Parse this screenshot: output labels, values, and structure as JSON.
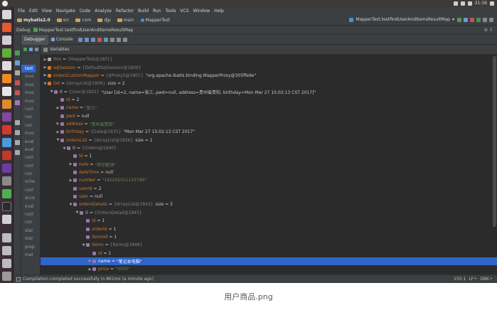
{
  "top_panel": {
    "tray_items": [
      "✉",
      "⇅",
      "♪",
      "21:16",
      "⚙"
    ]
  },
  "menu": {
    "items": [
      "File",
      "Edit",
      "View",
      "Navigate",
      "Code",
      "Analyze",
      "Refactor",
      "Build",
      "Run",
      "Tools",
      "VCS",
      "Window",
      "Help"
    ]
  },
  "nav": {
    "crumbs": [
      "mybatis2.0",
      "src",
      "com",
      "djp",
      "main",
      "MapperTest"
    ],
    "run_config": "MapperTest.testfindUserAndItemsResultMap"
  },
  "debug": {
    "title": "Debug",
    "config_name": "MapperTest.testfindUserAndItemsResultMap",
    "right_icons": "⚙ ↧"
  },
  "tabs": {
    "debugger": "Debugger",
    "console": "Console",
    "toolbar_icons": [
      "↑",
      "↓",
      "↘",
      "↗",
      "↱",
      "⦿",
      "⊕",
      "≡"
    ]
  },
  "frames": {
    "items": [
      "test",
      "invo",
      "invo",
      "invo",
      "invo",
      "runl",
      "run",
      "run",
      "invo",
      "eval",
      "eval",
      "runl",
      "runl",
      "run",
      "sche",
      "runl",
      "acce",
      "eval",
      "runl",
      "run",
      "star",
      "star",
      "prep",
      "mai"
    ]
  },
  "variables": {
    "header": "Variables",
    "rows": [
      {
        "indent": 0,
        "arrow": "▶",
        "kind": "local",
        "name": "this",
        "type": "{MapperTest@1801}",
        "value": ""
      },
      {
        "indent": 0,
        "arrow": "▶",
        "kind": "field",
        "name": "sqlSession",
        "type": "{DefaultSqlSession@1806}",
        "value": ""
      },
      {
        "indent": 0,
        "arrow": "▶",
        "kind": "field",
        "name": "ordersCustomMapper",
        "type": "{$Proxy5@1807}",
        "value": "\"org.apache.ibatis.binding.MapperProxy@305ffe9e\""
      },
      {
        "indent": 0,
        "arrow": "▼",
        "kind": "field",
        "name": "list",
        "type": "{ArrayList@1808}",
        "value": "size = 2"
      },
      {
        "indent": 1,
        "arrow": "▼",
        "kind": "idx",
        "name": "0",
        "type": "{User@1822}",
        "value": "\"User [id=2, name=张三, pwd=null, address=贵州省贵阳, birthday=Mon Mar 27 15:02:13 CST 2017]\""
      },
      {
        "indent": 2,
        "arrow": "",
        "kind": "fin",
        "name": "id",
        "type": "",
        "value": "2"
      },
      {
        "indent": 2,
        "arrow": "▶",
        "kind": "fin",
        "name": "name",
        "type": "",
        "value": "\"张三\""
      },
      {
        "indent": 2,
        "arrow": "",
        "kind": "fin",
        "name": "pwd",
        "type": "",
        "value": "null"
      },
      {
        "indent": 2,
        "arrow": "▶",
        "kind": "fin",
        "name": "address",
        "type": "",
        "value": "\"贵州省贵阳\""
      },
      {
        "indent": 2,
        "arrow": "▶",
        "kind": "fin",
        "name": "birthday",
        "type": "{Date@1835}",
        "value": "\"Mon Mar 27 15:02:13 CST 2017\""
      },
      {
        "indent": 2,
        "arrow": "▼",
        "kind": "fin",
        "name": "ordersList",
        "type": "{ArrayList@1836}",
        "value": "size = 1"
      },
      {
        "indent": 3,
        "arrow": "▼",
        "kind": "idx",
        "name": "0",
        "type": "{Orders@1840}",
        "value": ""
      },
      {
        "indent": 4,
        "arrow": "",
        "kind": "fin",
        "name": "id",
        "type": "",
        "value": "1"
      },
      {
        "indent": 4,
        "arrow": "▶",
        "kind": "fin",
        "name": "note",
        "type": "",
        "value": "\"布尔欧洲\""
      },
      {
        "indent": 4,
        "arrow": "",
        "kind": "fin",
        "name": "dateTime",
        "type": "",
        "value": "null"
      },
      {
        "indent": 4,
        "arrow": "▶",
        "kind": "fin",
        "name": "number",
        "type": "",
        "value": "\"145202011155789\""
      },
      {
        "indent": 4,
        "arrow": "",
        "kind": "fin",
        "name": "userId",
        "type": "",
        "value": "2"
      },
      {
        "indent": 4,
        "arrow": "",
        "kind": "fin",
        "name": "user",
        "type": "",
        "value": "null"
      },
      {
        "indent": 4,
        "arrow": "▼",
        "kind": "fin",
        "name": "ordersDetails",
        "type": "{ArrayList@1843}",
        "value": "size = 3"
      },
      {
        "indent": 5,
        "arrow": "▼",
        "kind": "idx",
        "name": "0",
        "type": "{OrdersDetail@1845}",
        "value": ""
      },
      {
        "indent": 6,
        "arrow": "",
        "kind": "fin",
        "name": "id",
        "type": "",
        "value": "1"
      },
      {
        "indent": 6,
        "arrow": "",
        "kind": "fin",
        "name": "orderId",
        "type": "",
        "value": "1"
      },
      {
        "indent": 6,
        "arrow": "",
        "kind": "fin",
        "name": "itemsId",
        "type": "",
        "value": "1"
      },
      {
        "indent": 6,
        "arrow": "▼",
        "kind": "fin",
        "name": "items",
        "type": "{Items@1848}",
        "value": ""
      },
      {
        "indent": 7,
        "arrow": "",
        "kind": "fin",
        "name": "id",
        "type": "",
        "value": "1"
      },
      {
        "indent": 7,
        "arrow": "▶",
        "kind": "fin",
        "name": "name",
        "type": "",
        "value": "\"笔记本电脑\"",
        "selected": true
      },
      {
        "indent": 7,
        "arrow": "▶",
        "kind": "fin",
        "name": "price",
        "type": "",
        "value": "\"4500\""
      }
    ]
  },
  "status": {
    "message": "Compilation completed successfully in 861ms (a minute ago)",
    "position": "155:1",
    "line_sep": "LF÷",
    "encoding": "GBK÷"
  },
  "caption": "用户商品.png",
  "colors": {
    "ide_bg": "#2b2b2b",
    "panel_bg": "#3c3f41",
    "selection": "#2f65ca",
    "field_name": "#cc7832",
    "string_value": "#6a8759",
    "type_gray": "#808080",
    "launcher_bg": "#3a2d35"
  }
}
